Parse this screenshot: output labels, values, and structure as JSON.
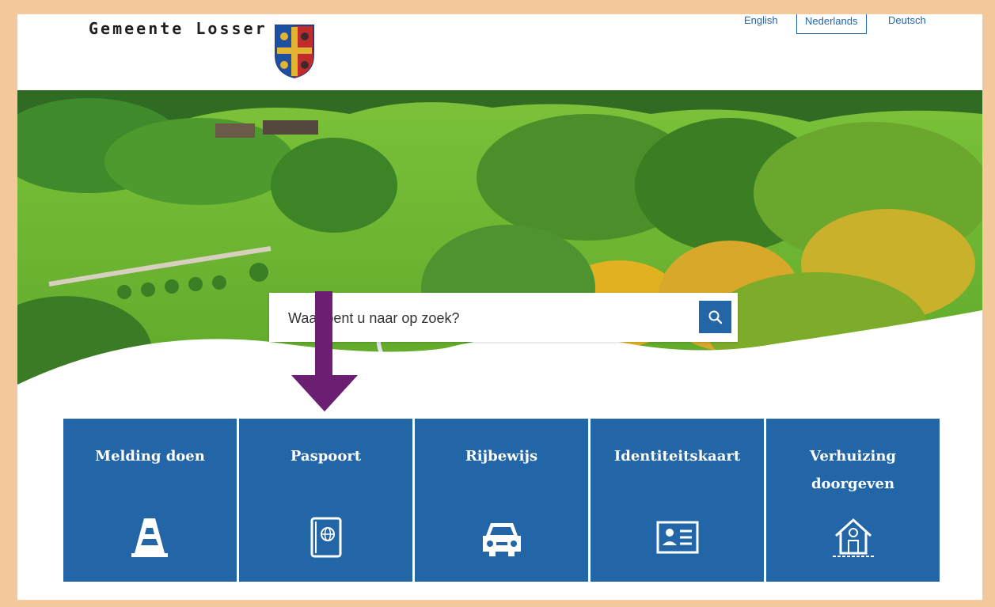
{
  "header": {
    "logo_text": "Gemeente Losser",
    "languages": [
      "English",
      "Nederlands",
      "Deutsch"
    ],
    "active_language": "Nederlands"
  },
  "search": {
    "placeholder": "Waar bent u naar op zoek?",
    "icon": "search-icon"
  },
  "tiles": [
    {
      "label": "Melding doen",
      "icon": "traffic-cone-icon"
    },
    {
      "label": "Paspoort",
      "icon": "passport-icon"
    },
    {
      "label": "Rijbewijs",
      "icon": "car-icon"
    },
    {
      "label": "Identiteitskaart",
      "icon": "id-card-icon"
    },
    {
      "label": "Verhuizing doorgeven",
      "icon": "house-icon"
    }
  ],
  "colors": {
    "brand_blue": "#2266a8",
    "annotation_arrow": "#6b1f73",
    "frame_border": "#f3c99b"
  }
}
